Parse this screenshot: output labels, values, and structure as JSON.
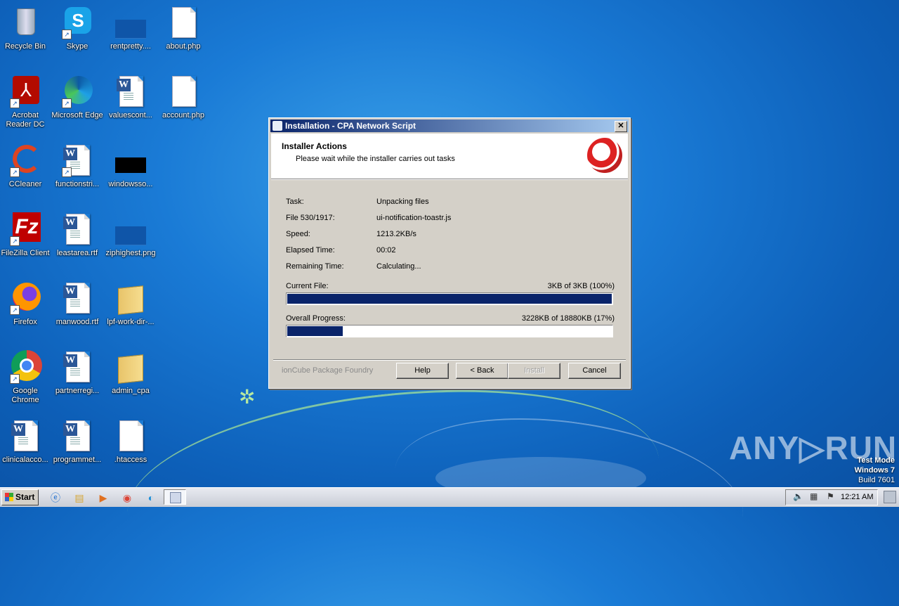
{
  "desktop": {
    "icons": [
      {
        "label": "Recycle Bin"
      },
      {
        "label": "Skype"
      },
      {
        "label": "rentpretty...."
      },
      {
        "label": "about.php"
      },
      {
        "label": "Acrobat Reader DC"
      },
      {
        "label": "Microsoft Edge"
      },
      {
        "label": "valuescont..."
      },
      {
        "label": "account.php"
      },
      {
        "label": "CCleaner"
      },
      {
        "label": "functionstri..."
      },
      {
        "label": "windowsso..."
      },
      {
        "label": "FileZilla Client"
      },
      {
        "label": "leastarea.rtf"
      },
      {
        "label": "ziphighest.png"
      },
      {
        "label": "Firefox"
      },
      {
        "label": "manwood.rtf"
      },
      {
        "label": "lpf-work-dir-..."
      },
      {
        "label": "Google Chrome"
      },
      {
        "label": "partnerregi..."
      },
      {
        "label": "admin_cpa"
      },
      {
        "label": "clinicalacco..."
      },
      {
        "label": "programmet..."
      },
      {
        "label": ".htaccess"
      }
    ]
  },
  "dialog": {
    "title": "Installation - CPA Network Script",
    "close_label": "✕",
    "header_title": "Installer Actions",
    "header_subtitle": "Please wait while the installer carries out tasks",
    "rows": [
      {
        "label": "Task:",
        "value": "Unpacking files"
      },
      {
        "label": "File 530/1917:",
        "value": "ui-notification-toastr.js"
      },
      {
        "label": "Speed:",
        "value": "1213.2KB/s"
      },
      {
        "label": "Elapsed Time:",
        "value": "00:02"
      },
      {
        "label": "Remaining Time:",
        "value": "Calculating..."
      }
    ],
    "current_file": {
      "label": "Current File:",
      "status": "3KB of 3KB (100%)",
      "progress": 1.0
    },
    "overall": {
      "label": "Overall Progress:",
      "status": "3228KB of 18880KB (17%)",
      "progress": 0.17
    },
    "brand": "ionCube Package Foundry",
    "buttons": {
      "help": "Help",
      "back": "< Back",
      "install": "Install",
      "cancel": "Cancel"
    }
  },
  "taskbar": {
    "start_label": "Start",
    "clock": "12:21 AM"
  },
  "watermark": "ANY▷RUN",
  "test_mode": {
    "line1": "Test Mode",
    "line2": "Windows 7",
    "line3": "Build 7601"
  },
  "colors": {
    "progress_fill": "#0a246a",
    "title_gradient_start": "#0a246a",
    "desktop_blue": "#1a7bd6"
  }
}
